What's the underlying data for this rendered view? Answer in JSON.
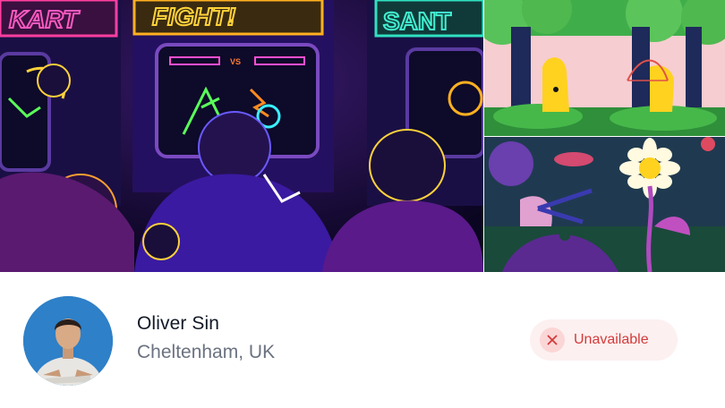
{
  "profile": {
    "name": "Oliver Sin",
    "location": "Cheltenham, UK"
  },
  "status": {
    "label": "Unavailable",
    "icon": "close-icon"
  },
  "gallery": {
    "main_image": {
      "signs": [
        "KART",
        "FIGHT!",
        "SANT"
      ],
      "screen_text": "VS"
    }
  },
  "colors": {
    "status_text": "#d33b3b",
    "status_bg": "#fdf0f0",
    "name": "#111827",
    "location": "#6b7280"
  }
}
